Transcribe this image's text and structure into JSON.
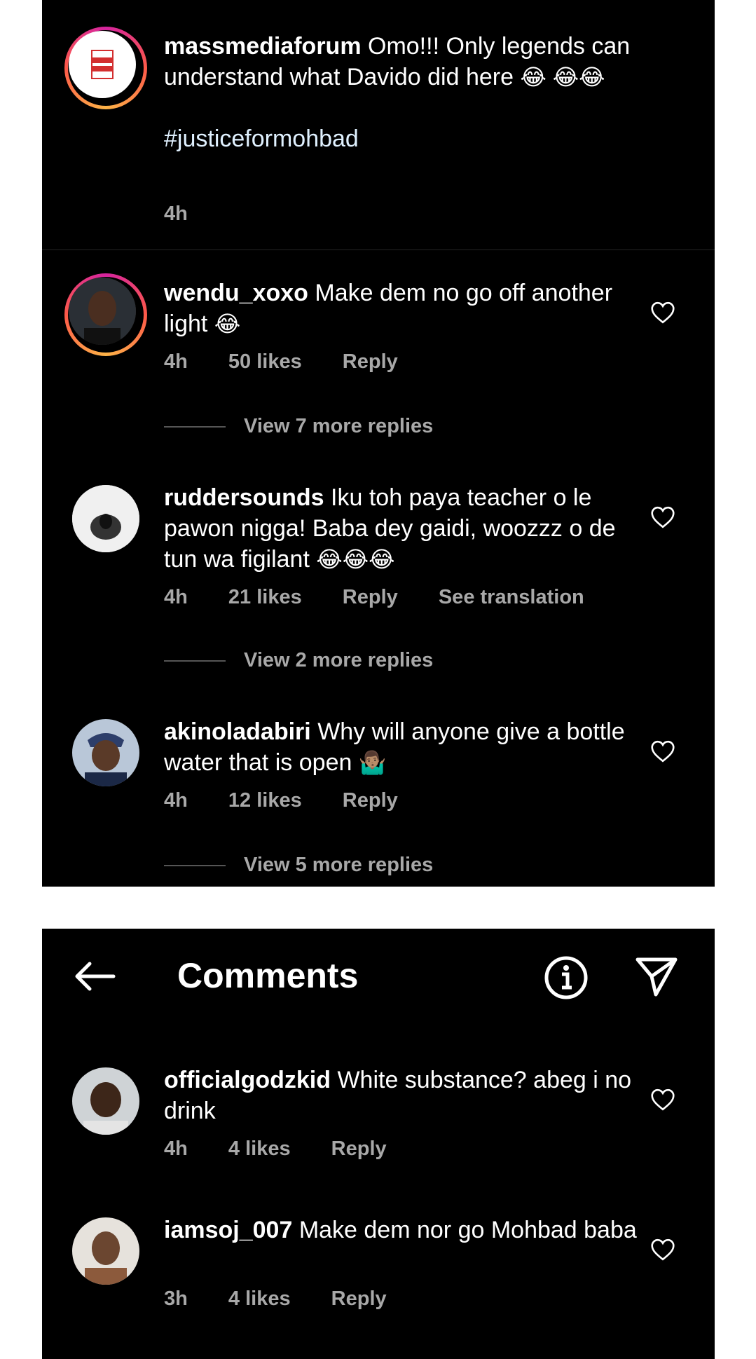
{
  "top_panel": {
    "post": {
      "username": "massmediaforum",
      "text": "Omo!!! Only legends can understand what Davido did here",
      "emojis": "😂 😂😂",
      "hashtag": "#justiceformohbad",
      "time": "4h"
    },
    "comments": [
      {
        "username": "wendu_xoxo",
        "text": "Make dem no go off another light",
        "emoji": "😂",
        "time": "4h",
        "likes": "50 likes",
        "reply": "Reply",
        "view_replies": "View 7 more replies"
      },
      {
        "username": "ruddersounds",
        "text": "Iku toh paya teacher o le pawon nigga! Baba dey gaidi, woozzz o de tun wa figilant",
        "emoji": "😂😂😂",
        "time": "4h",
        "likes": "21 likes",
        "reply": "Reply",
        "translation": "See translation",
        "view_replies": "View 2 more replies"
      },
      {
        "username": "akinoladabiri",
        "text": "Why will anyone give a bottle water that is open",
        "emoji": "🤷🏽‍♂️",
        "time": "4h",
        "likes": "12 likes",
        "reply": "Reply",
        "view_replies": "View 5 more replies"
      }
    ]
  },
  "bottom_panel": {
    "header": {
      "title": "Comments",
      "back_icon": "arrow-left-icon",
      "info_icon": "info-icon",
      "share_icon": "paper-plane-icon"
    },
    "comments": [
      {
        "username": "officialgodzkid",
        "text": "White substance? abeg i no drink",
        "time": "4h",
        "likes": "4 likes",
        "reply": "Reply"
      },
      {
        "username": "iamsoj_007",
        "text": "Make dem nor go Mohbad baba",
        "time": "3h",
        "likes": "4 likes",
        "reply": "Reply"
      }
    ]
  },
  "colors": {
    "background": "#000000",
    "text": "#ffffff",
    "secondary_text": "#a8a8a8",
    "page": "#ffffff"
  }
}
